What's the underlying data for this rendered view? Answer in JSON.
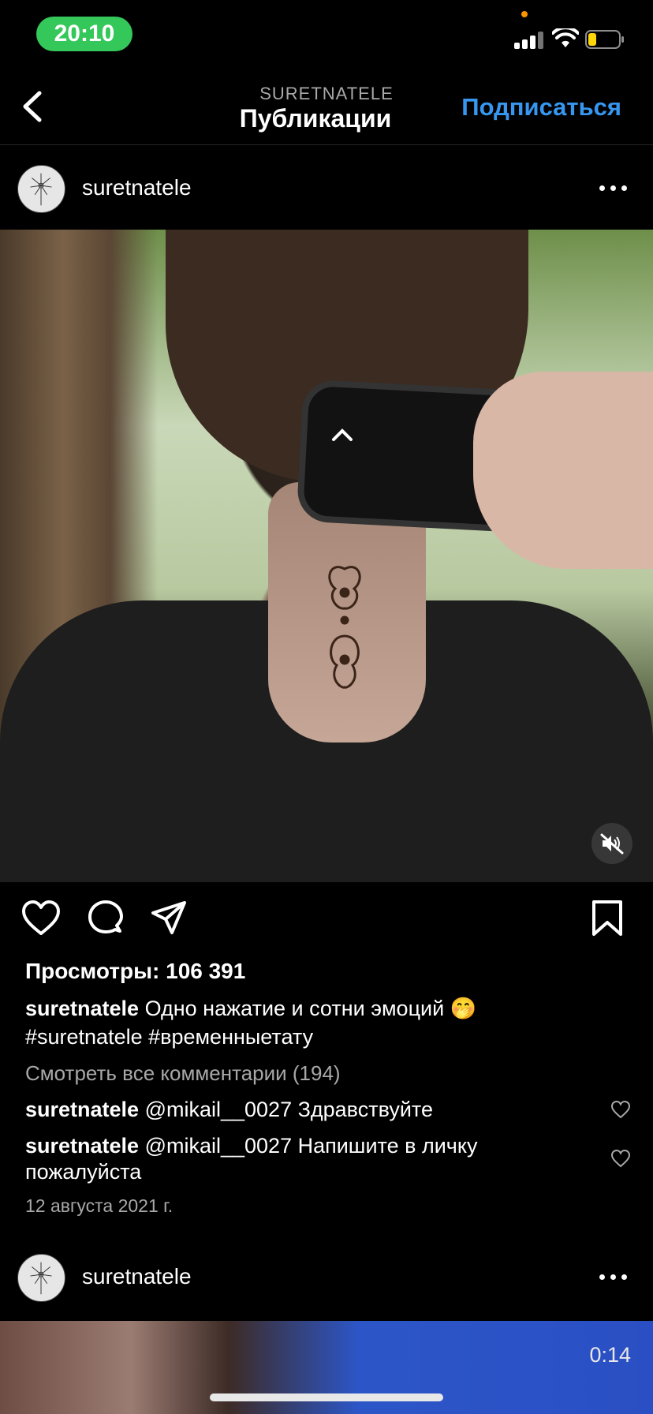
{
  "status_bar": {
    "time": "20:10"
  },
  "header": {
    "subtitle": "SURETNATELE",
    "title": "Публикации",
    "follow_label": "Подписаться"
  },
  "post": {
    "username": "suretnatele",
    "views": "Просмотры: 106 391",
    "caption_user": "suretnatele",
    "caption_text": "Одно нажатие и сотни эмоций 🤭",
    "caption_tags": "#suretnatele #временныетату",
    "view_all_comments": "Смотреть все комментарии (194)",
    "comments": [
      {
        "user": "suretnatele",
        "text": "@mikail__0027 Здравствуйте"
      },
      {
        "user": "suretnatele",
        "text": "@mikail__0027 Напишите в личку пожалуйста"
      }
    ],
    "date": "12 августа 2021 г."
  },
  "next_post": {
    "username": "suretnatele",
    "duration": "0:14"
  },
  "colors": {
    "accent": "#3797f0",
    "time_pill": "#34c759"
  },
  "icons": [
    "back-chevron-icon",
    "heart-icon",
    "comment-icon",
    "share-icon",
    "bookmark-icon",
    "more-icon",
    "mute-icon"
  ]
}
